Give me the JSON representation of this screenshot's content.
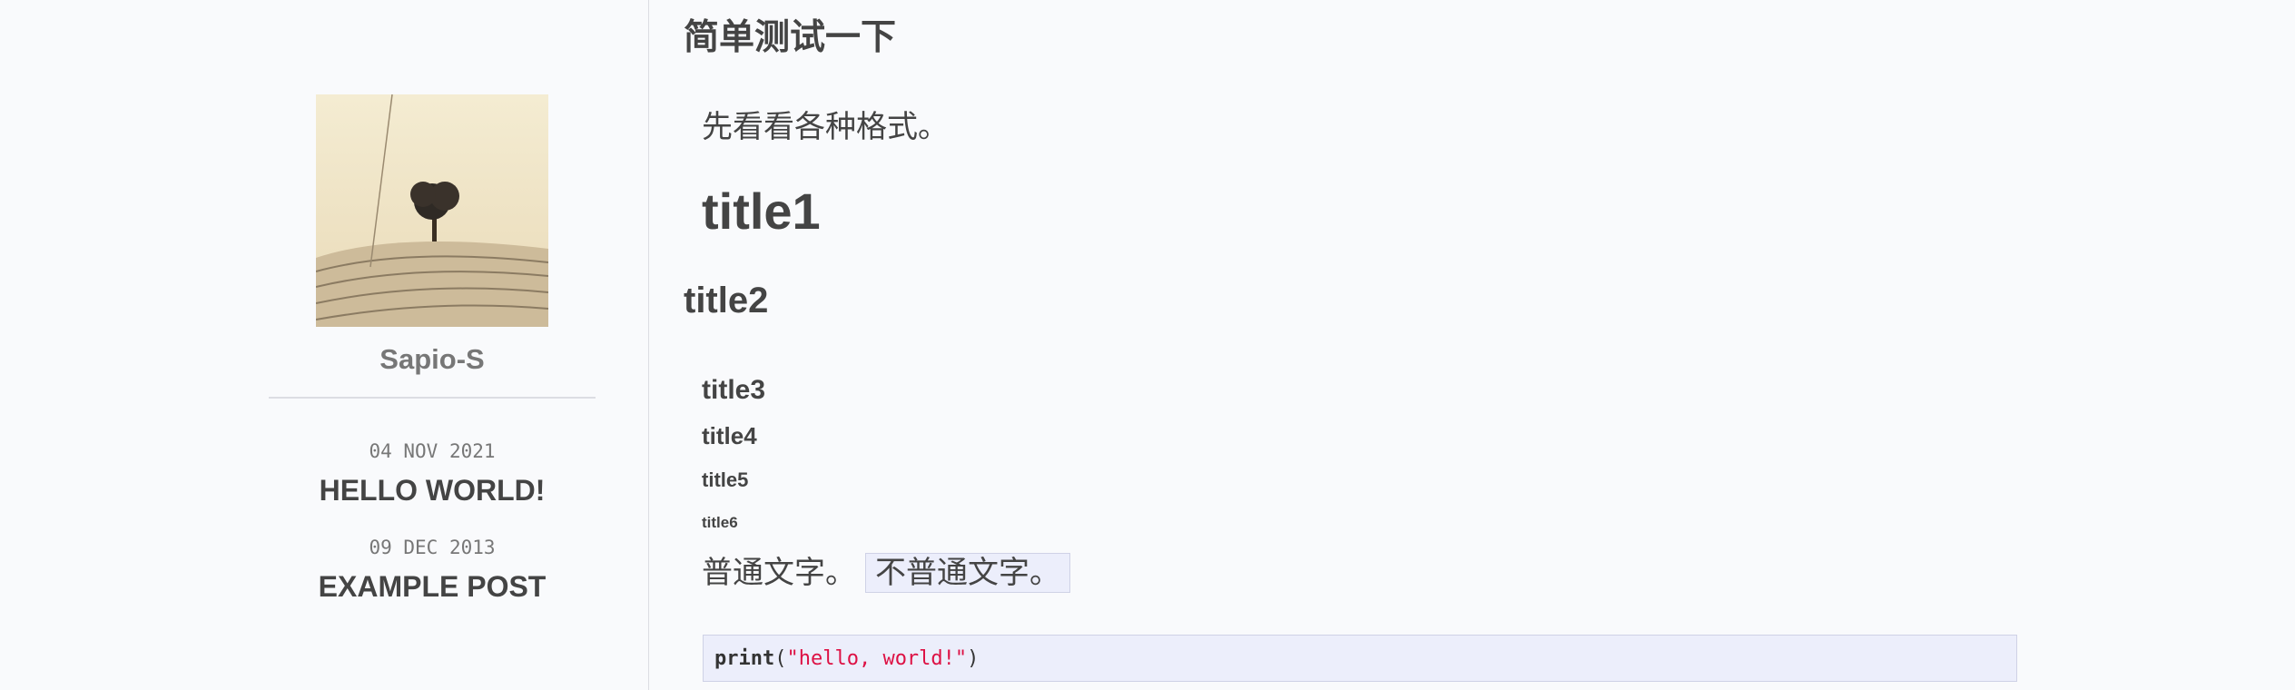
{
  "sidebar": {
    "author": "Sapio-S",
    "posts": [
      {
        "date": "04 NOV 2021",
        "title": "HELLO WORLD!"
      },
      {
        "date": "09 DEC 2013",
        "title": "EXAMPLE POST"
      }
    ]
  },
  "article": {
    "title": "简单测试一下",
    "intro": "先看看各种格式。",
    "headings": {
      "h1": "title1",
      "h2": "title2",
      "h3": "title3",
      "h4": "title4",
      "h5": "title5",
      "h6": "title6"
    },
    "plain_text": "普通文字。",
    "inline_code": "不普通文字。",
    "code": {
      "keyword": "print",
      "open_paren": "(",
      "string": "\"hello, world!\"",
      "close_paren": ")"
    }
  }
}
